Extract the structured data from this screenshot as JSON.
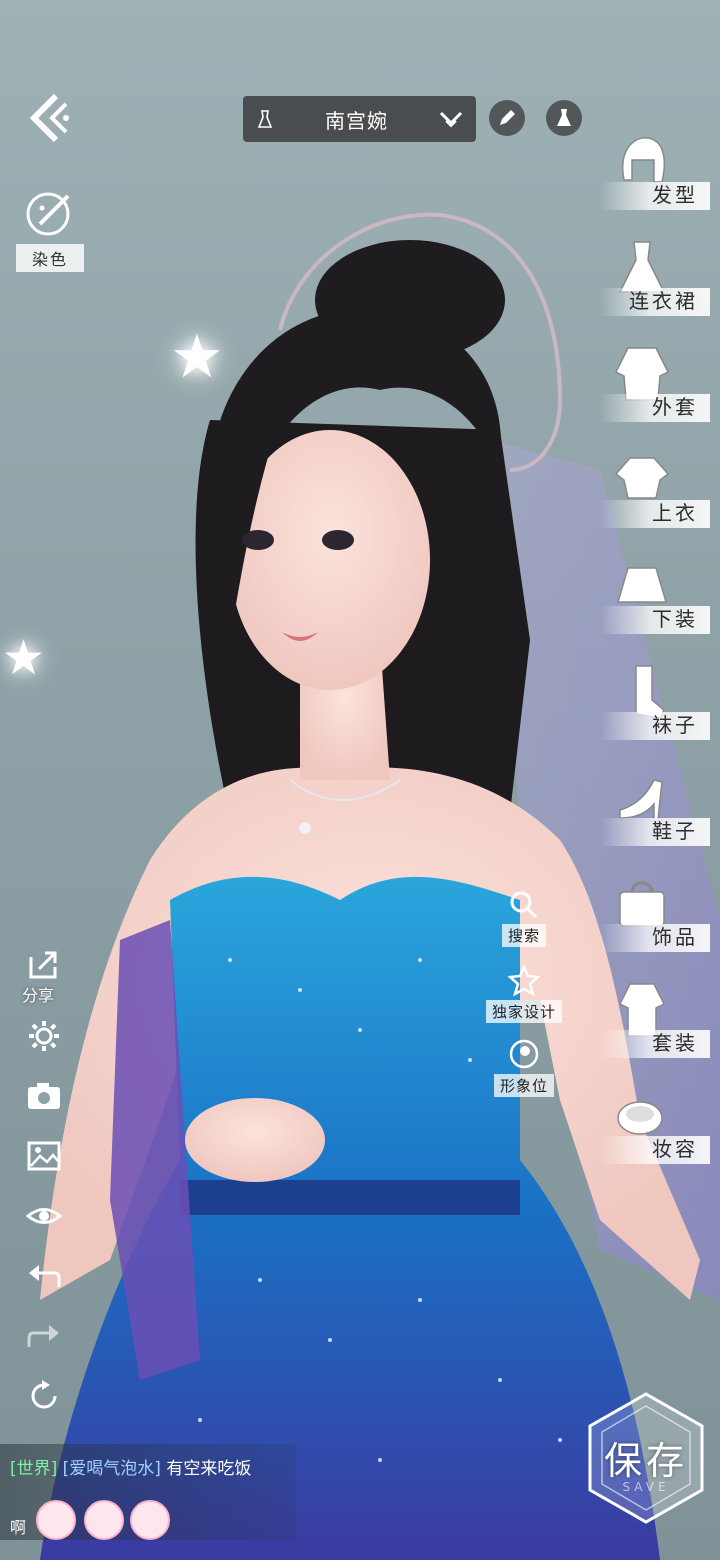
{
  "top": {
    "character_name": "南宫婉"
  },
  "dye": {
    "label": "染色"
  },
  "categories": [
    {
      "id": "hair",
      "label": "发型"
    },
    {
      "id": "dress",
      "label": "连衣裙"
    },
    {
      "id": "coat",
      "label": "外套"
    },
    {
      "id": "top",
      "label": "上衣"
    },
    {
      "id": "bottom",
      "label": "下装"
    },
    {
      "id": "socks",
      "label": "袜子"
    },
    {
      "id": "shoes",
      "label": "鞋子"
    },
    {
      "id": "accessory",
      "label": "饰品"
    },
    {
      "id": "set",
      "label": "套装"
    },
    {
      "id": "makeup",
      "label": "妆容"
    }
  ],
  "middle_actions": {
    "search": "搜索",
    "exclusive_design": "独家设计",
    "image_slot": "形象位"
  },
  "left_tools": {
    "share_label": "分享"
  },
  "chat": {
    "channel": "[世界]",
    "user": "[爱喝气泡水]",
    "message": "有空来吃饭",
    "second_line_prefix": "啊"
  },
  "save": {
    "label": "保存",
    "watermark": "SAVE"
  }
}
